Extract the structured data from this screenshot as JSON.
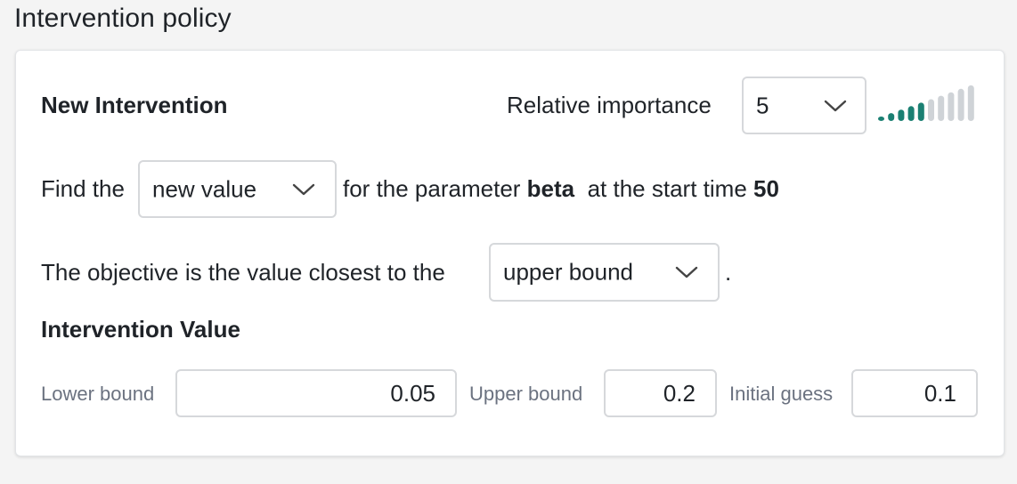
{
  "section": {
    "title": "Intervention policy"
  },
  "intervention": {
    "heading": "New Intervention",
    "importance_label": "Relative importance",
    "importance_value": "5",
    "importance_level": 5,
    "importance_max": 10,
    "importance_colors": {
      "active": "#1b8073",
      "inactive": "#cfd3d7"
    },
    "find_prefix": "Find the",
    "find_type": "new value",
    "param_prefix": "for the parameter",
    "param_name": "beta",
    "time_prefix": "at the start time",
    "time_value": "50",
    "objective_prefix": "The objective is the value closest to the",
    "objective_value": "upper bound",
    "objective_suffix": ".",
    "value_heading": "Intervention Value",
    "lower_bound_label": "Lower bound",
    "lower_bound_value": "0.05",
    "upper_bound_label": "Upper bound",
    "upper_bound_value": "0.2",
    "initial_guess_label": "Initial guess",
    "initial_guess_value": "0.1"
  }
}
